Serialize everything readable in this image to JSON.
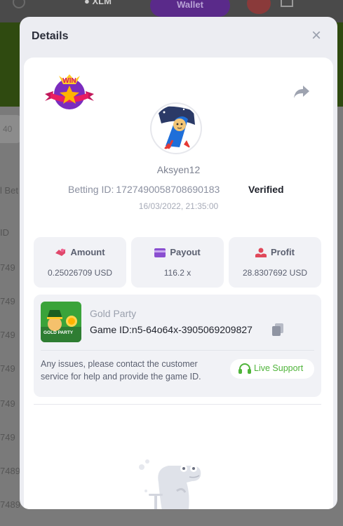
{
  "background": {
    "coin_label": "XLM",
    "wallet_label": "Wallet",
    "chip_label": "40",
    "side_labels": [
      "l Bet",
      "ID",
      "749",
      "749",
      "749",
      "749",
      "749",
      "749",
      "7489",
      "7489"
    ]
  },
  "modal": {
    "title": "Details",
    "close_icon": "×"
  },
  "bet": {
    "username": "Aksyen12",
    "betting_id_label": "Betting ID:",
    "betting_id": "1727490058708690183",
    "verified_label": "Verified",
    "timestamp": "16/03/2022, 21:35:00"
  },
  "stats": {
    "amount": {
      "label": "Amount",
      "value": "0.25026709 USD"
    },
    "payout": {
      "label": "Payout",
      "value": "116.2 x"
    },
    "profit": {
      "label": "Profit",
      "value": "28.8307692 USD"
    }
  },
  "game": {
    "name": "Gold Party",
    "id_label": "Game ID:",
    "id_value": "n5-64o64x-3905069209827",
    "thumb_text": "GOLD PARTY",
    "issue_text": "Any issues, please contact the customer service for help and provide the game ID.",
    "support_label": "Live Support"
  },
  "colors": {
    "accent_green": "#4fb43a",
    "amount_icon": "#e0486b",
    "payout_icon": "#8a4fd0",
    "profit_icon": "#e0485a"
  }
}
